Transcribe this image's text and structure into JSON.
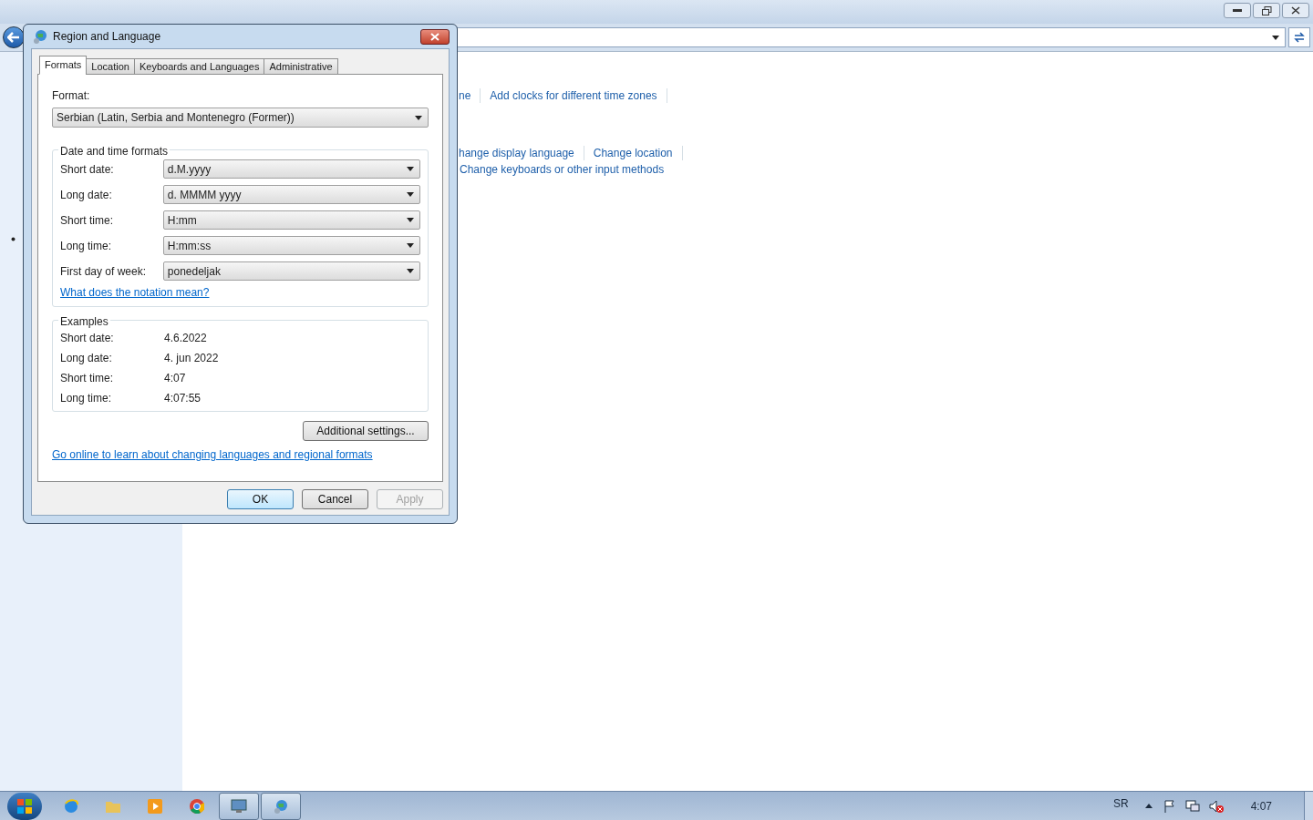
{
  "content": {
    "link_rows": [
      [
        "ne",
        "Add clocks for different time zones"
      ],
      [
        "hange display language",
        "Change location"
      ],
      [
        "Change keyboards or other input methods"
      ]
    ]
  },
  "dialog": {
    "title": "Region and Language",
    "tabs": [
      {
        "label": "Formats",
        "selected": true
      },
      {
        "label": "Location",
        "selected": false
      },
      {
        "label": "Keyboards and Languages",
        "selected": false
      },
      {
        "label": "Administrative",
        "selected": false
      }
    ],
    "format_label": "Format:",
    "format_value": "Serbian (Latin, Serbia and Montenegro (Former))",
    "formats_group": {
      "title": "Date and time formats",
      "fields": [
        {
          "label": "Short date:",
          "value": "d.M.yyyy"
        },
        {
          "label": "Long date:",
          "value": "d. MMMM yyyy"
        },
        {
          "label": "Short time:",
          "value": "H:mm"
        },
        {
          "label": "Long time:",
          "value": "H:mm:ss"
        },
        {
          "label": "First day of week:",
          "value": "ponedeljak"
        }
      ],
      "link": "What does the notation mean?"
    },
    "examples_group": {
      "title": "Examples",
      "rows": [
        {
          "label": "Short date:",
          "value": "4.6.2022"
        },
        {
          "label": "Long date:",
          "value": "4. jun 2022"
        },
        {
          "label": "Short time:",
          "value": "4:07"
        },
        {
          "label": "Long time:",
          "value": "4:07:55"
        }
      ]
    },
    "additional_button": "Additional settings...",
    "online_link": "Go online to learn about changing languages and regional formats",
    "buttons": [
      {
        "label": "OK",
        "disabled": false
      },
      {
        "label": "Cancel",
        "disabled": false
      },
      {
        "label": "Apply",
        "disabled": true
      }
    ]
  },
  "taskbar": {
    "apps": [
      {
        "kind": "browser",
        "running": false
      },
      {
        "kind": "folder",
        "running": false
      },
      {
        "kind": "media",
        "running": false
      },
      {
        "kind": "chrome",
        "running": false
      },
      {
        "kind": "monitor",
        "running": true
      },
      {
        "kind": "globe",
        "running": true
      }
    ],
    "language": "SR",
    "clock": "4:07"
  }
}
